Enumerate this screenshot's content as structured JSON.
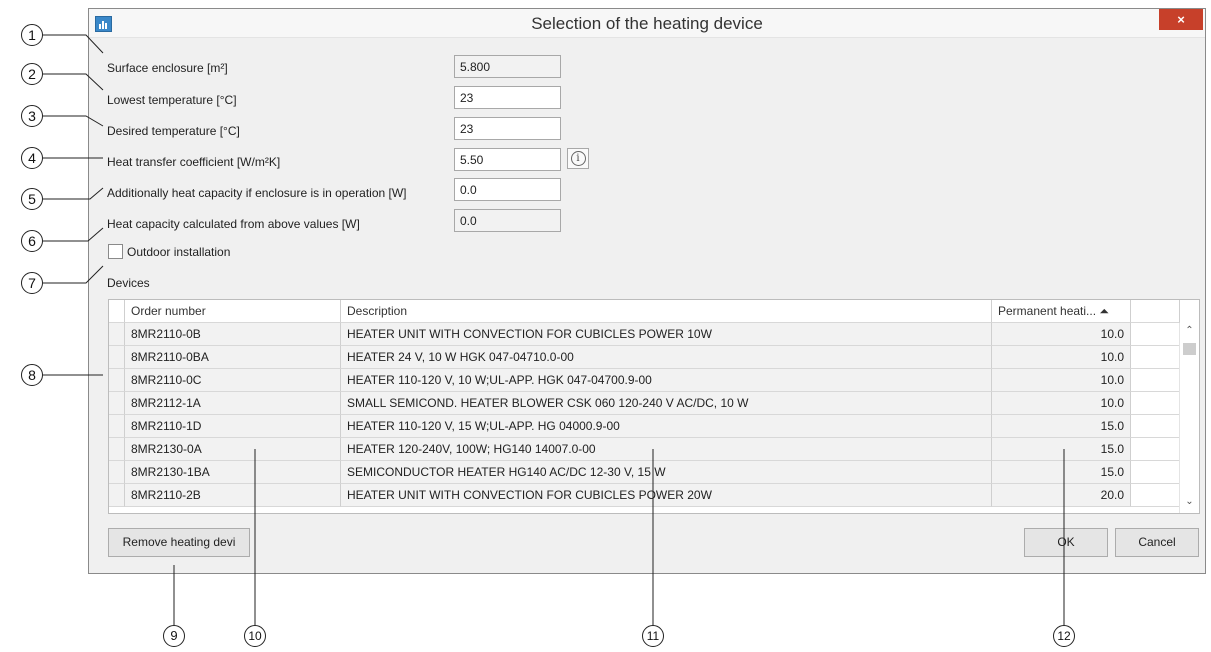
{
  "window": {
    "title": "Selection of the heating device",
    "close_glyph": "×",
    "icon": "app-grid-icon"
  },
  "form": {
    "surface_label": "Surface enclosure [m²]",
    "surface_value": "5.800",
    "lowest_label": "Lowest temperature [°C]",
    "lowest_value": "23",
    "desired_label": "Desired temperature [°C]",
    "desired_value": "23",
    "coeff_label": "Heat transfer coefficient [W/m²K]",
    "coeff_value": "5.50",
    "info_glyph": "i",
    "additional_label": "Additionally heat capacity if enclosure is in operation [W]",
    "additional_value": "0.0",
    "calculated_label": "Heat capacity calculated from above values [W]",
    "calculated_value": "0.0",
    "outdoor_label": "Outdoor installation",
    "outdoor_checked": false,
    "devices_label": "Devices"
  },
  "table": {
    "headers": {
      "order": "Order number",
      "description": "Description",
      "power": "Permanent heati... ⏶"
    },
    "rows": [
      {
        "order": "8MR2110-0B",
        "description": "HEATER UNIT WITH CONVECTION FOR CUBICLES POWER 10W",
        "power": "10.0"
      },
      {
        "order": "8MR2110-0BA",
        "description": "HEATER 24 V, 10 W HGK 047-04710.0-00",
        "power": "10.0"
      },
      {
        "order": "8MR2110-0C",
        "description": "HEATER 110-120 V, 10 W;UL-APP. HGK 047-04700.9-00",
        "power": "10.0"
      },
      {
        "order": "8MR2112-1A",
        "description": "SMALL SEMICOND. HEATER BLOWER CSK 060 120-240 V AC/DC, 10 W",
        "power": "10.0"
      },
      {
        "order": "8MR2110-1D",
        "description": "HEATER 110-120 V, 15 W;UL-APP. HG  04000.9-00",
        "power": "15.0"
      },
      {
        "order": "8MR2130-0A",
        "description": "HEATER 120-240V, 100W; HG140 14007.0-00",
        "power": "15.0"
      },
      {
        "order": "8MR2130-1BA",
        "description": "SEMICONDUCTOR HEATER HG140 AC/DC 12-30 V, 15 W",
        "power": "15.0"
      },
      {
        "order": "8MR2110-2B",
        "description": "HEATER UNIT WITH CONVECTION FOR CUBICLES POWER 20W",
        "power": "20.0"
      }
    ],
    "scroll_up": "⌃",
    "scroll_down": "⌄"
  },
  "buttons": {
    "remove": "Remove heating devi",
    "ok": "OK",
    "cancel": "Cancel"
  },
  "callouts": [
    "1",
    "2",
    "3",
    "4",
    "5",
    "6",
    "7",
    "8",
    "9",
    "10",
    "11",
    "12"
  ]
}
